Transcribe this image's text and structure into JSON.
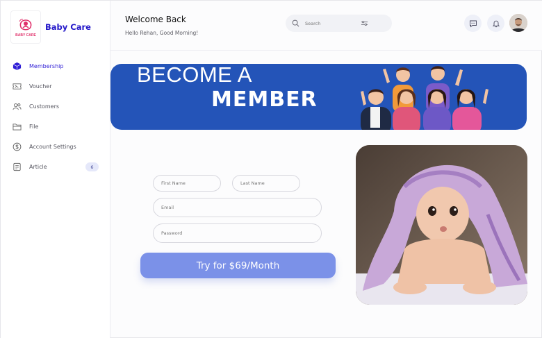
{
  "brand": {
    "name": "Baby Care",
    "logo_text": "BABY CARE"
  },
  "sidebar": {
    "items": [
      {
        "label": "Membership",
        "icon": "cube-icon",
        "active": true
      },
      {
        "label": "Voucher",
        "icon": "ticket-icon",
        "active": false
      },
      {
        "label": "Customers",
        "icon": "users-icon",
        "active": false
      },
      {
        "label": "File",
        "icon": "folder-icon",
        "active": false
      },
      {
        "label": "Account Settings",
        "icon": "dollar-circle-icon",
        "active": false
      },
      {
        "label": "Article",
        "icon": "document-icon",
        "active": false,
        "badge": "6"
      }
    ]
  },
  "header": {
    "welcome": "Welcome Back",
    "greeting": "Hello Rehan, Good Morning!",
    "search_placeholder": "Search"
  },
  "banner": {
    "line1": "BECOME A",
    "line2": "MEMBER"
  },
  "form": {
    "first_name_placeholder": "First Name",
    "last_name_placeholder": "Last Name",
    "email_placeholder": "Email",
    "password_placeholder": "Password",
    "submit_label": "Try for $69/Month"
  },
  "colors": {
    "accent": "#2f1ed6",
    "banner_bg": "#2454b8",
    "cta_bg": "#7b91e8"
  }
}
